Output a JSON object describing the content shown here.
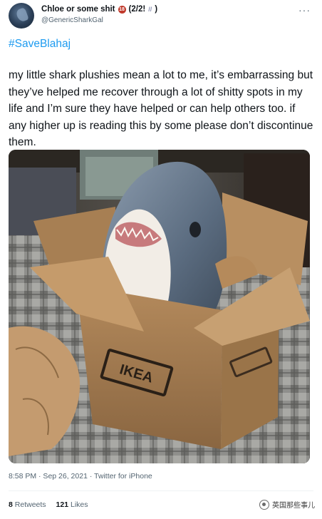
{
  "tweet": {
    "display_name": "Chloe or some shit",
    "name_badge": "18",
    "name_suffix": "(2/2!",
    "name_close": ")",
    "handle": "@GenericSharkGal",
    "more_label": "···",
    "hashtag": "#SaveBlahaj",
    "text": "my little shark plushies mean a lot to me, it’s embarrassing but they’ve helped me recover through a lot of shitty spots in my life and I’m sure they have helped or can help others too. if any higher up is reading this by some please don’t discontinue them.",
    "timestamp": "8:58 PM · Sep 26, 2021 · Twitter for iPhone",
    "retweets_count": "8",
    "retweets_label": "Retweets",
    "likes_count": "121",
    "likes_label": "Likes"
  },
  "photo": {
    "box_brand": "IKEA"
  },
  "watermark": {
    "text": "英国那些事儿"
  },
  "colors": {
    "link": "#1d9bf0",
    "secondary_text": "#536471",
    "primary_text": "#0f1419"
  }
}
